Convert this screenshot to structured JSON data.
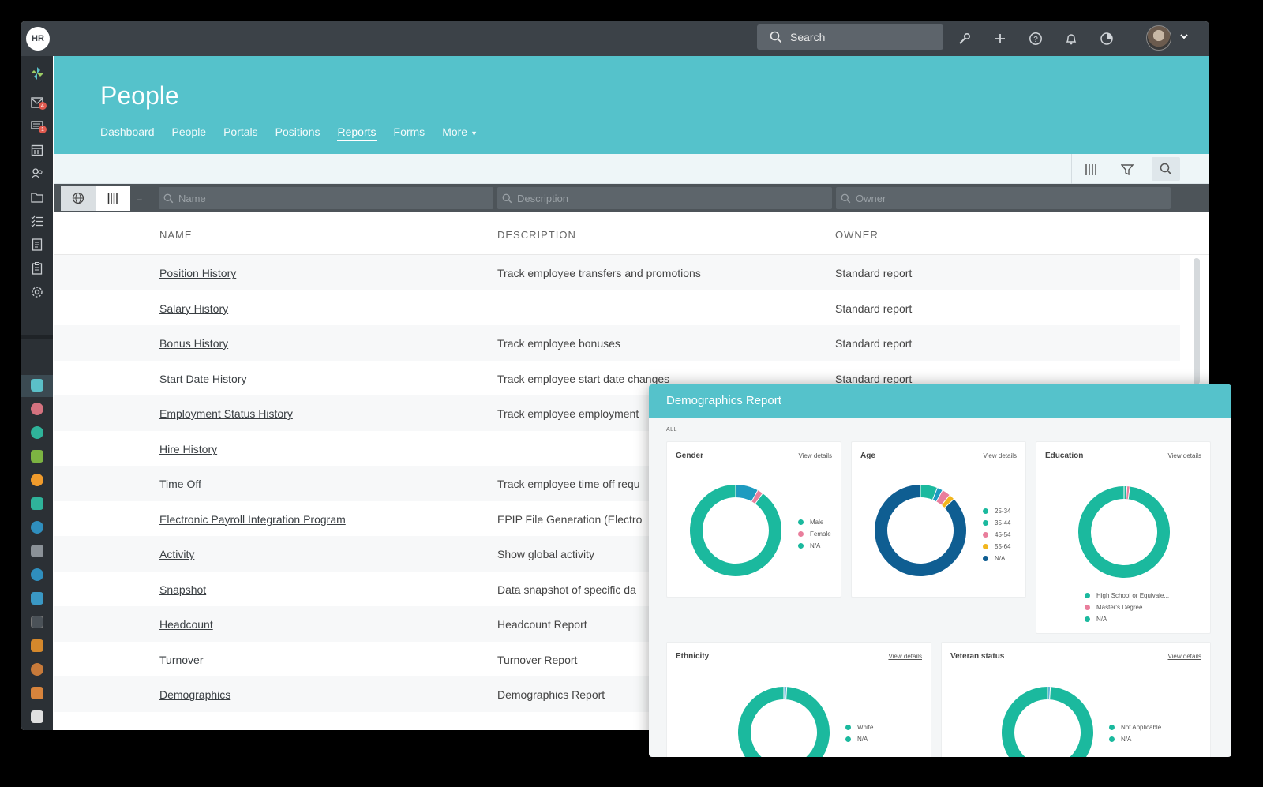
{
  "app": {
    "logo": "HR",
    "search_label": "Search"
  },
  "rail": {
    "badges": [
      "4",
      "1"
    ]
  },
  "header": {
    "title": "People",
    "nav": [
      {
        "label": "Dashboard",
        "active": false
      },
      {
        "label": "People",
        "active": false
      },
      {
        "label": "Portals",
        "active": false
      },
      {
        "label": "Positions",
        "active": false
      },
      {
        "label": "Reports",
        "active": true
      },
      {
        "label": "Forms",
        "active": false
      },
      {
        "label": "More",
        "active": false
      }
    ]
  },
  "filters": {
    "name_placeholder": "Name",
    "description_placeholder": "Description",
    "owner_placeholder": "Owner"
  },
  "table": {
    "columns": [
      "NAME",
      "DESCRIPTION",
      "OWNER"
    ],
    "rows": [
      {
        "name": "Position History",
        "description": "Track employee transfers and promotions",
        "owner": "Standard report"
      },
      {
        "name": "Salary History",
        "description": "",
        "owner": "Standard report"
      },
      {
        "name": "Bonus History",
        "description": "Track employee bonuses",
        "owner": "Standard report"
      },
      {
        "name": "Start Date History",
        "description": "Track employee start date changes",
        "owner": "Standard report"
      },
      {
        "name": "Employment Status History",
        "description": "Track employee employment",
        "owner": ""
      },
      {
        "name": "Hire History",
        "description": "",
        "owner": ""
      },
      {
        "name": "Time Off",
        "description": "Track employee time off requ",
        "owner": ""
      },
      {
        "name": "Electronic Payroll Integration Program",
        "description": "EPIP File Generation (Electro",
        "owner": ""
      },
      {
        "name": "Activity",
        "description": "Show global activity",
        "owner": ""
      },
      {
        "name": "Snapshot",
        "description": "Data snapshot of specific da",
        "owner": ""
      },
      {
        "name": "Headcount",
        "description": "Headcount Report",
        "owner": ""
      },
      {
        "name": "Turnover",
        "description": "Turnover Report",
        "owner": ""
      },
      {
        "name": "Demographics",
        "description": "Demographics Report",
        "owner": ""
      }
    ]
  },
  "demographics": {
    "title": "Demographics Report",
    "scope": "ALL",
    "view_details": "View details",
    "colors": {
      "teal": "#1bb99e",
      "blue": "#1e9bc0",
      "pink": "#e97e9c",
      "yellow": "#f2b61e",
      "navy": "#0f5e92",
      "lightblue": "#5fb3d8"
    }
  },
  "chart_data": [
    {
      "type": "pie",
      "title": "Gender",
      "categories": [
        "Male",
        "Female",
        "N/A"
      ],
      "values": [
        8,
        2,
        90
      ]
    },
    {
      "type": "pie",
      "title": "Age",
      "categories": [
        "25-34",
        "35-44",
        "45-54",
        "55-64",
        "N/A"
      ],
      "values": [
        6,
        2,
        3,
        2,
        87
      ]
    },
    {
      "type": "pie",
      "title": "Education",
      "categories": [
        "High School or Equivale...",
        "Master's Degree",
        "N/A"
      ],
      "values": [
        1,
        1,
        98
      ]
    },
    {
      "type": "pie",
      "title": "Ethnicity",
      "categories": [
        "White",
        "N/A"
      ],
      "values": [
        1,
        99
      ]
    },
    {
      "type": "pie",
      "title": "Veteran status",
      "categories": [
        "Not Applicable",
        "N/A"
      ],
      "values": [
        1,
        99
      ]
    }
  ]
}
